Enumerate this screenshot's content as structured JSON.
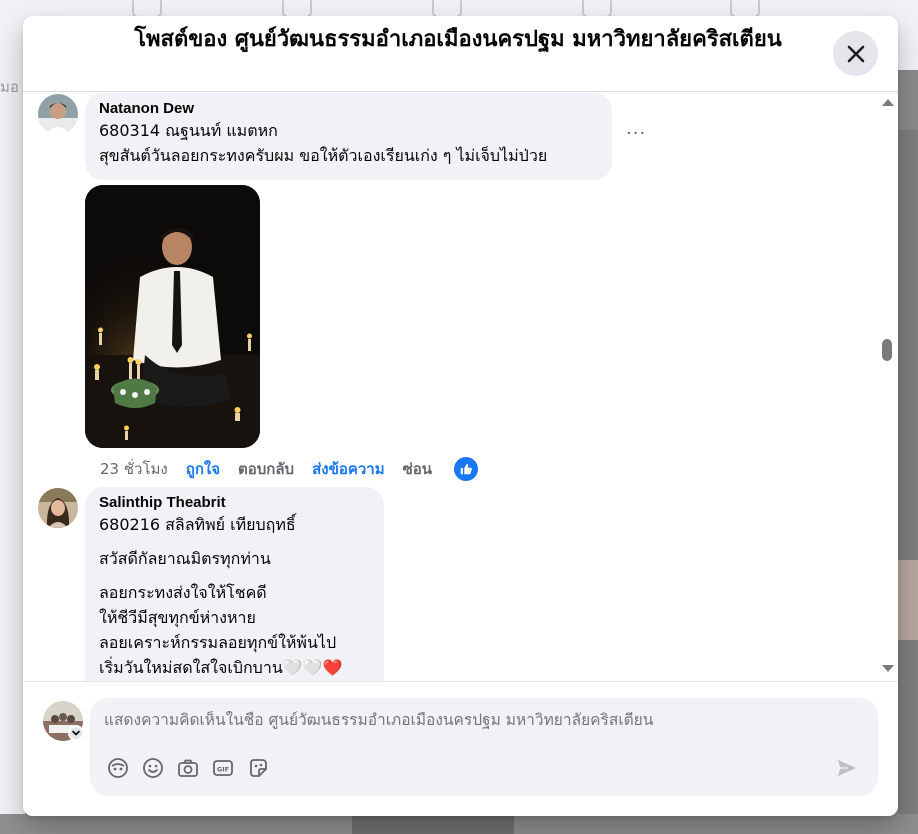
{
  "background": {
    "ghost_text": "มอ"
  },
  "modal": {
    "title": "โพสต์ของ ศูนย์วัฒนธรรมอำเภอเมืองนครปฐม มหาวิทยาลัยคริสเตียน",
    "close_icon": "close-icon"
  },
  "comments": [
    {
      "author": "Natanon Dew",
      "lines": [
        "680314 ณฐนนท์ แมตหก",
        "สุขสันต์วันลอยกระทงครับผม ขอให้ตัวเองเรียนเก่ง ๆ ไม่เจ็บไม่ป่วย"
      ],
      "more": "···",
      "image_alt": "ชายในชุดเชิ้ตขาวกับกระทงและเทียน",
      "actions": {
        "time": "23 ชั่วโมง",
        "like": "ถูกใจ",
        "reply": "ตอบกลับ",
        "message": "ส่งข้อความ",
        "hide": "ซ่อน"
      },
      "reaction_icon": "thumbs-up-icon"
    },
    {
      "author": "Salinthip Theabrit",
      "paragraphs": [
        [
          "680216 สลิลทิพย์ เทียบฤทธิ์"
        ],
        [
          "สวัสดีกัลยาณมิตรทุกท่าน"
        ],
        [
          "ลอยกระทงส่งใจให้โชคดี",
          "ให้ชีวีมีสุขทุกข์ห่างหาย",
          "ลอยเคราะห์กรรมลอยทุกข์ให้พ้นไป",
          "เริ่มวันใหม่สดใสใจเบิกบาน🤍🤍❤️"
        ]
      ]
    }
  ],
  "composer": {
    "placeholder": "แสดงความคิดเห็นในชื่อ ศูนย์วัฒนธรรมอำเภอเมืองนครปฐม มหาวิทยาลัยคริสเตียน",
    "tools": [
      "avatar-sticker-icon",
      "emoji-icon",
      "camera-icon",
      "gif-icon",
      "sticker-icon"
    ],
    "send_icon": "send-icon"
  },
  "colors": {
    "accent": "#1877f2",
    "bubble": "#f0f2f5",
    "secondary_text": "#65676b"
  }
}
